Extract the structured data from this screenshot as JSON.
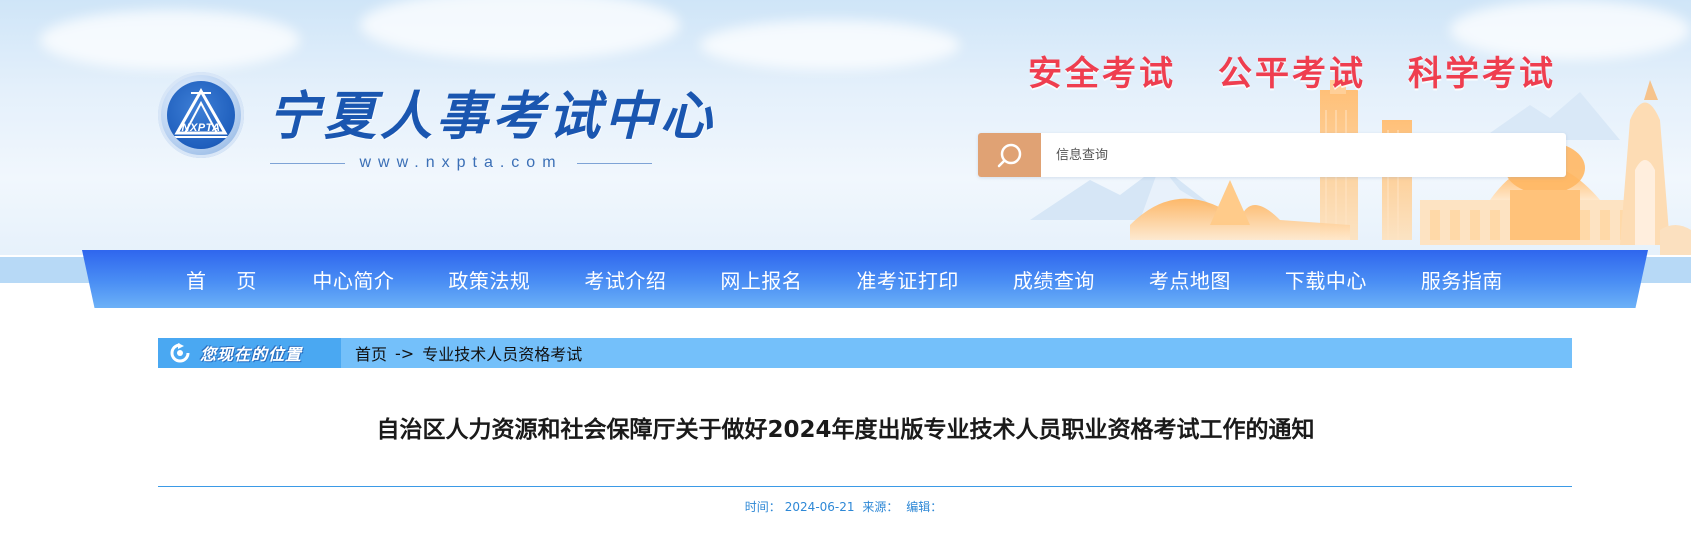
{
  "header": {
    "site_title": "宁夏人事考试中心",
    "site_url": "www.nxpta.com",
    "logo_abbr": "NXPTA",
    "slogans": [
      "安全考试",
      "公平考试",
      "科学考试"
    ],
    "search": {
      "placeholder": "信息查询",
      "icon": "search-icon"
    }
  },
  "nav": {
    "items": [
      {
        "label": "首 页"
      },
      {
        "label": "中心简介"
      },
      {
        "label": "政策法规"
      },
      {
        "label": "考试介绍"
      },
      {
        "label": "网上报名"
      },
      {
        "label": "准考证打印"
      },
      {
        "label": "成绩查询"
      },
      {
        "label": "考点地图"
      },
      {
        "label": "下载中心"
      },
      {
        "label": "服务指南"
      }
    ]
  },
  "breadcrumb": {
    "label": "您现在的位置",
    "home": "首页",
    "separator": "->",
    "current": "专业技术人员资格考试"
  },
  "article": {
    "title": "自治区人力资源和社会保障厅关于做好2024年度出版专业技术人员职业资格考试工作的通知",
    "time_label": "时间：",
    "time": "2024-06-21",
    "source_label": "来源：",
    "editor_label": "编辑："
  },
  "colors": {
    "nav_top": "#2f66ee",
    "nav_bottom": "#6cb1f7",
    "slogan": "#ef3e4f",
    "title_blue": "#1a56b0",
    "search_button": "#e0a274",
    "breadcrumb_bg": "#74c0fa",
    "meta_text": "#2e88d6"
  }
}
